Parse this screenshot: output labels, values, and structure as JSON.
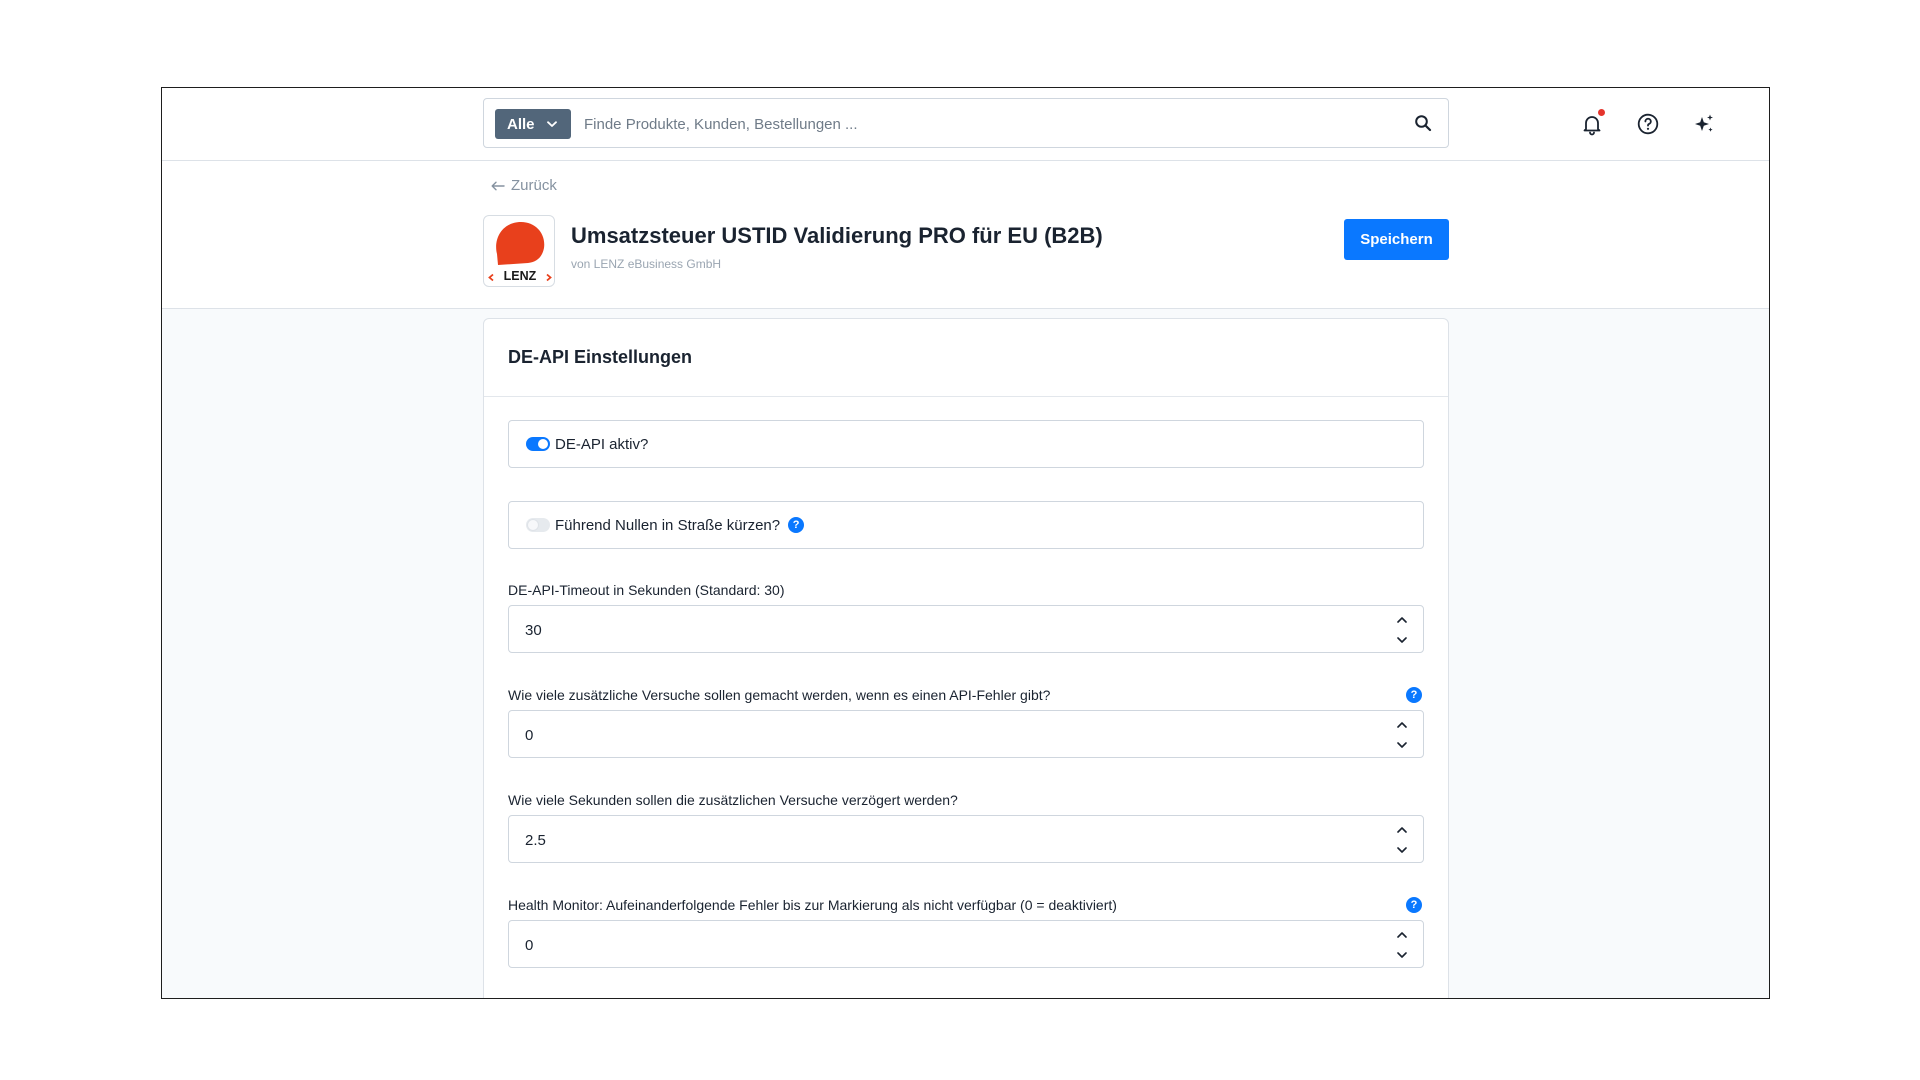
{
  "header": {
    "search": {
      "scope_label": "Alle",
      "placeholder": "Finde Produkte, Kunden, Bestellungen ...",
      "value": ""
    },
    "icons": [
      "bell-icon",
      "help-circle-icon",
      "sparkle-icon"
    ],
    "notification_dot_color": "#e5352d"
  },
  "page": {
    "back_label": "Zurück",
    "app_title": "Umsatzsteuer USTID Validierung PRO für EU (B2B)",
    "app_vendor": "von LENZ eBusiness GmbH",
    "logo_text": "<LENZ>",
    "save_label": "Speichern"
  },
  "colors": {
    "primary": "#0a78ff",
    "scope_button": "#52667a",
    "logo_red": "#e8401c"
  },
  "card": {
    "title": "DE-API Einstellungen",
    "toggles": [
      {
        "label": "DE-API aktiv?",
        "checked": true,
        "has_help": false
      },
      {
        "label": "Führend Nullen in Straße kürzen?",
        "checked": false,
        "has_help": true
      }
    ],
    "fields": [
      {
        "label": "DE-API-Timeout in Sekunden (Standard: 30)",
        "value": "30",
        "has_help": false
      },
      {
        "label": "Wie viele zusätzliche Versuche sollen gemacht werden, wenn es einen API-Fehler gibt?",
        "value": "0",
        "has_help": true
      },
      {
        "label": "Wie viele Sekunden sollen die zusätzlichen Versuche verzögert werden?",
        "value": "2.5",
        "has_help": false
      },
      {
        "label": "Health Monitor: Aufeinanderfolgende Fehler bis zur Markierung als nicht verfügbar (0 = deaktiviert)",
        "value": "0",
        "has_help": true
      }
    ],
    "help_glyph": "?"
  }
}
